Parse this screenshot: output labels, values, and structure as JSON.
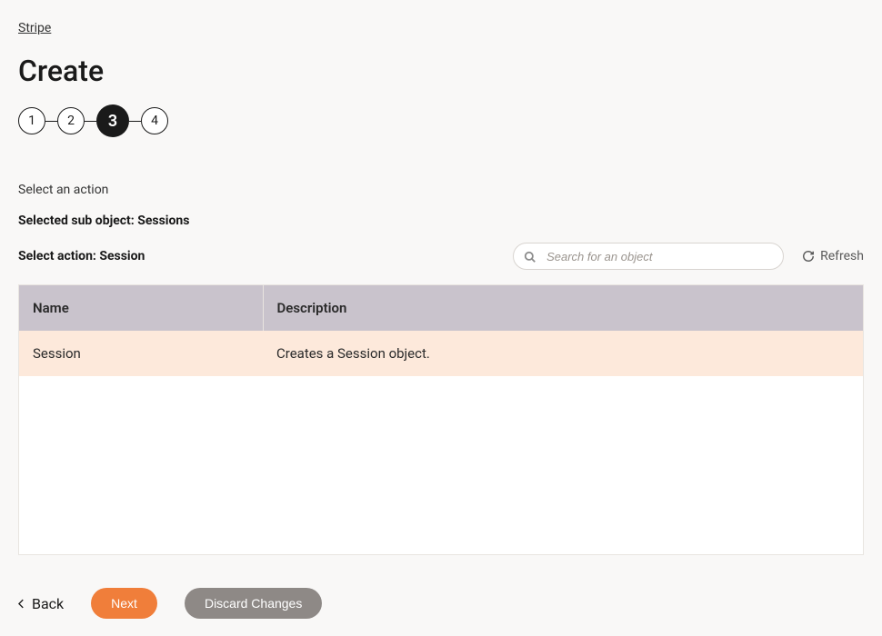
{
  "breadcrumb": "Stripe",
  "page_title": "Create",
  "stepper": {
    "steps": [
      "1",
      "2",
      "3",
      "4"
    ],
    "active_index": 2
  },
  "section_label": "Select an action",
  "selected_sub_object_line": "Selected sub object: Sessions",
  "select_action_line": "Select action: Session",
  "search": {
    "placeholder": "Search for an object"
  },
  "refresh_label": "Refresh",
  "table": {
    "headers": {
      "name": "Name",
      "description": "Description"
    },
    "rows": [
      {
        "name": "Session",
        "description": "Creates a Session object.",
        "selected": true
      }
    ]
  },
  "footer": {
    "back": "Back",
    "next": "Next",
    "discard": "Discard Changes"
  }
}
